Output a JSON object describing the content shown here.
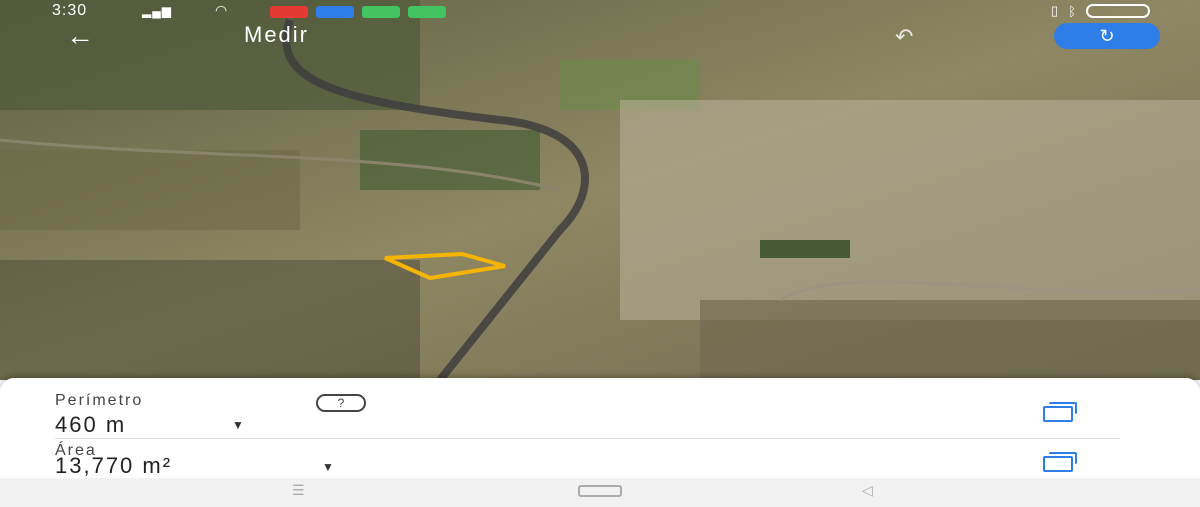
{
  "status_bar": {
    "time": "3:30",
    "signal_icon": "signal-icon",
    "wifi_icon": "wifi-icon",
    "app_icons": [
      "#e53935",
      "#2f7ee8",
      "#43c463",
      "#43c463"
    ],
    "bluetooth_icon": "bluetooth-icon",
    "battery_icon": "battery-icon"
  },
  "top_bar": {
    "back_icon": "arrow-left-icon",
    "title": "Medir",
    "undo_icon": "undo-icon",
    "action_icon": "refresh-icon",
    "accent": "#2f7ee8"
  },
  "measurement": {
    "perimeter_label": "Perímetro",
    "perimeter_value": "460 m",
    "help_label": "?",
    "area_label": "Área",
    "area_value": "13,770 m²",
    "polygon_color": "#f5b400"
  },
  "nav": {
    "menu_icon": "menu-icon",
    "home_icon": "home-icon",
    "back_icon": "triangle-back-icon"
  }
}
